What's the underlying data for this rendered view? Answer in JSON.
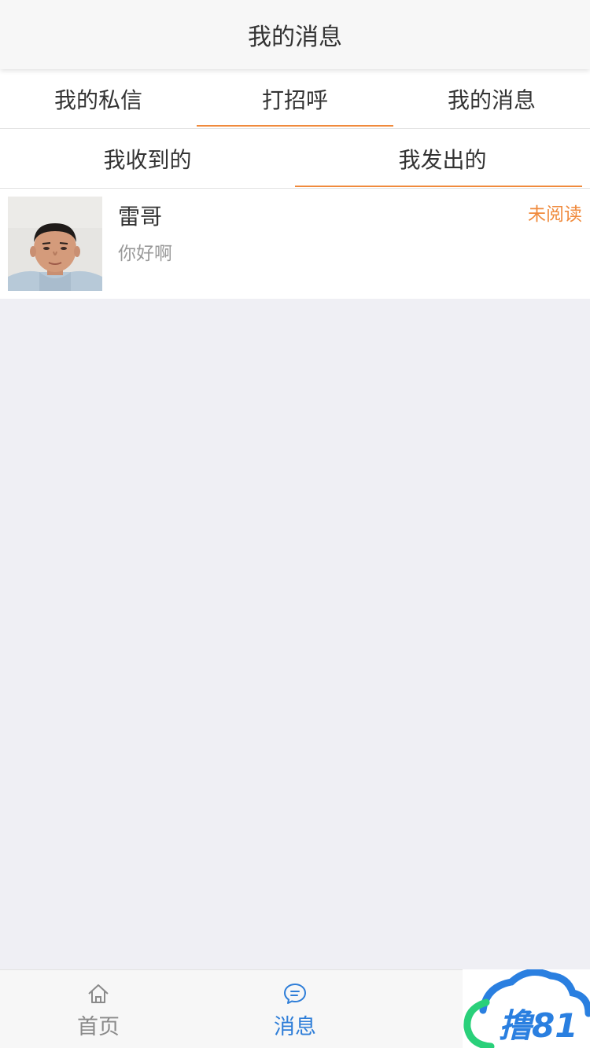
{
  "header": {
    "title": "我的消息"
  },
  "main_tabs": [
    {
      "label": "我的私信",
      "active": false
    },
    {
      "label": "打招呼",
      "active": true
    },
    {
      "label": "我的消息",
      "active": false
    }
  ],
  "sub_tabs": [
    {
      "label": "我收到的",
      "active": false
    },
    {
      "label": "我发出的",
      "active": true
    }
  ],
  "messages": [
    {
      "name": "雷哥",
      "preview": "你好啊",
      "status": "未阅读",
      "avatar_icon": "user-photo"
    }
  ],
  "tabbar": {
    "items": [
      {
        "label": "首页",
        "icon": "home-icon",
        "active": false
      },
      {
        "label": "消息",
        "icon": "chat-bubble-icon",
        "active": true
      }
    ]
  },
  "watermark": {
    "text": "撸81"
  },
  "colors": {
    "accent": "#f08a3c",
    "active_blue": "#2f7ed8",
    "background": "#efeff4",
    "watermark_blue": "#2a7fe0",
    "watermark_green": "#2ad07a"
  }
}
